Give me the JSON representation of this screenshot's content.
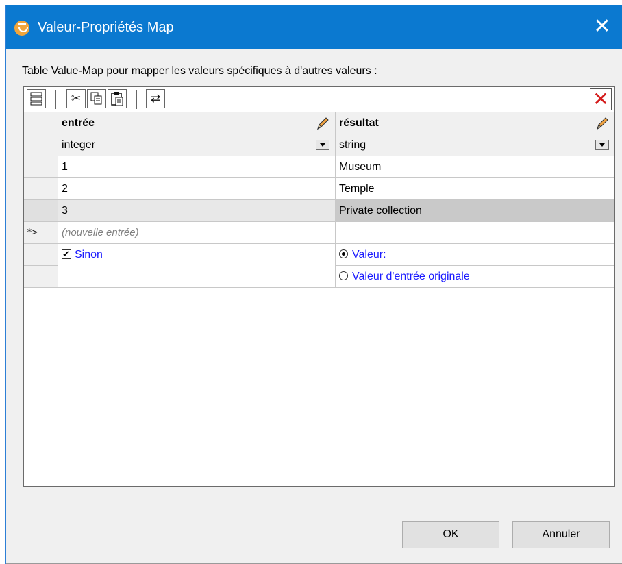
{
  "window": {
    "title": "Valeur-Propriétés Map",
    "close_glyph": "✕",
    "app_icon": "mapforce-icon",
    "accent_color": "#0b79d0"
  },
  "caption": "Table  Value-Map pour mapper les valeurs spécifiques à d'autres valeurs :",
  "toolbar": {
    "buttons": [
      {
        "name": "insert-row-icon",
        "glyph": "⧉"
      },
      {
        "name": "cut-icon",
        "glyph": "✂"
      },
      {
        "name": "copy-icon",
        "glyph": "⎘"
      },
      {
        "name": "paste-icon",
        "glyph": "📋"
      },
      {
        "name": "swap-columns-icon",
        "glyph": "⇄"
      },
      {
        "name": "delete-icon",
        "glyph": "✕"
      }
    ]
  },
  "table": {
    "columns": [
      {
        "label": "entrée",
        "type": "integer"
      },
      {
        "label": "résultat",
        "type": "string"
      }
    ],
    "rows": [
      {
        "input": "1",
        "output": "Museum"
      },
      {
        "input": "2",
        "output": "Temple"
      },
      {
        "input": "3",
        "output": "Private collection",
        "selected": true
      }
    ],
    "new_row_marker": "*>",
    "new_row_placeholder": "(nouvelle entrée)",
    "otherwise": {
      "label": "Sinon",
      "checked": true,
      "options": [
        {
          "label": "Valeur:",
          "selected": true
        },
        {
          "label": "Valeur d'entrée originale",
          "selected": false
        }
      ]
    }
  },
  "buttons": {
    "ok": "OK",
    "cancel": "Annuler"
  }
}
